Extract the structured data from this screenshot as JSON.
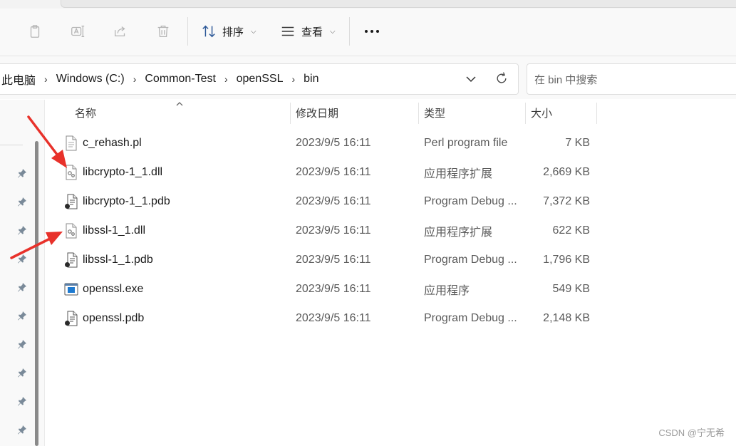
{
  "toolbar": {
    "icons": [
      "copy-icon",
      "rename-icon",
      "share-icon",
      "delete-icon"
    ],
    "sort_label": "排序",
    "view_label": "查看",
    "more_label": "更多"
  },
  "address": {
    "crumbs": [
      "此电脑",
      "Windows (C:)",
      "Common-Test",
      "openSSL",
      "bin"
    ]
  },
  "search": {
    "placeholder": "在 bin 中搜索"
  },
  "columns": {
    "name": "名称",
    "date": "修改日期",
    "type": "类型",
    "size": "大小"
  },
  "files": [
    {
      "name": "c_rehash.pl",
      "date": "2023/9/5 16:11",
      "type": "Perl program file",
      "size": "7 KB",
      "icon": "text-file-icon"
    },
    {
      "name": "libcrypto-1_1.dll",
      "date": "2023/9/5 16:11",
      "type": "应用程序扩展",
      "size": "2,669 KB",
      "icon": "dll-file-icon"
    },
    {
      "name": "libcrypto-1_1.pdb",
      "date": "2023/9/5 16:11",
      "type": "Program Debug ...",
      "size": "7,372 KB",
      "icon": "pdb-file-icon"
    },
    {
      "name": "libssl-1_1.dll",
      "date": "2023/9/5 16:11",
      "type": "应用程序扩展",
      "size": "622 KB",
      "icon": "dll-file-icon"
    },
    {
      "name": "libssl-1_1.pdb",
      "date": "2023/9/5 16:11",
      "type": "Program Debug ...",
      "size": "1,796 KB",
      "icon": "pdb-file-icon"
    },
    {
      "name": "openssl.exe",
      "date": "2023/9/5 16:11",
      "type": "应用程序",
      "size": "549 KB",
      "icon": "exe-file-icon"
    },
    {
      "name": "openssl.pdb",
      "date": "2023/9/5 16:11",
      "type": "Program Debug ...",
      "size": "2,148 KB",
      "icon": "pdb-file-icon"
    }
  ],
  "watermark": "CSDN @宁无希",
  "colors": {
    "annotation_arrow": "#e8312a",
    "accent": "#0067c0"
  }
}
